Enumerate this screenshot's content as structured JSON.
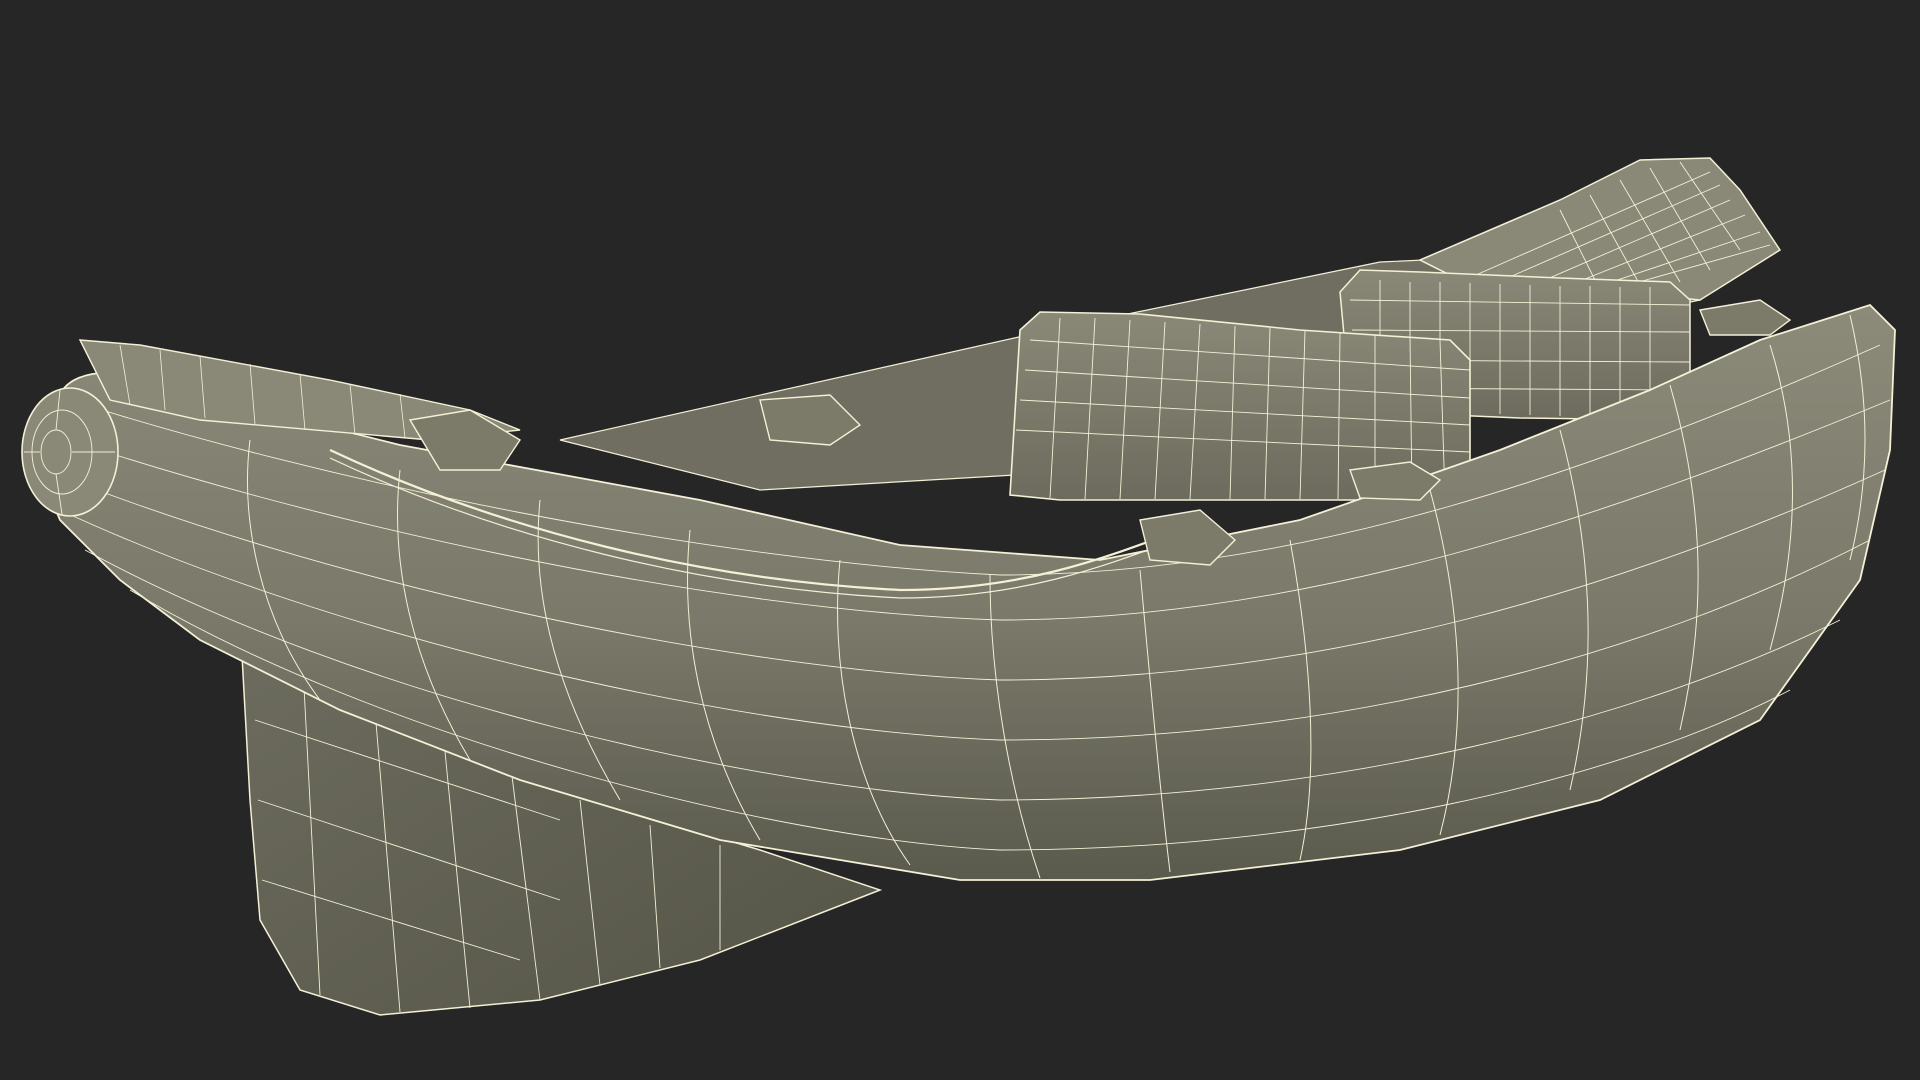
{
  "scene": {
    "subject": "inflatable-kayak-wireframe",
    "colors": {
      "background": "#262626",
      "surface": "#7c7b6a",
      "surface_dark": "#5f5e50",
      "surface_light": "#8a897a",
      "wire": "#f3f0d6"
    }
  }
}
